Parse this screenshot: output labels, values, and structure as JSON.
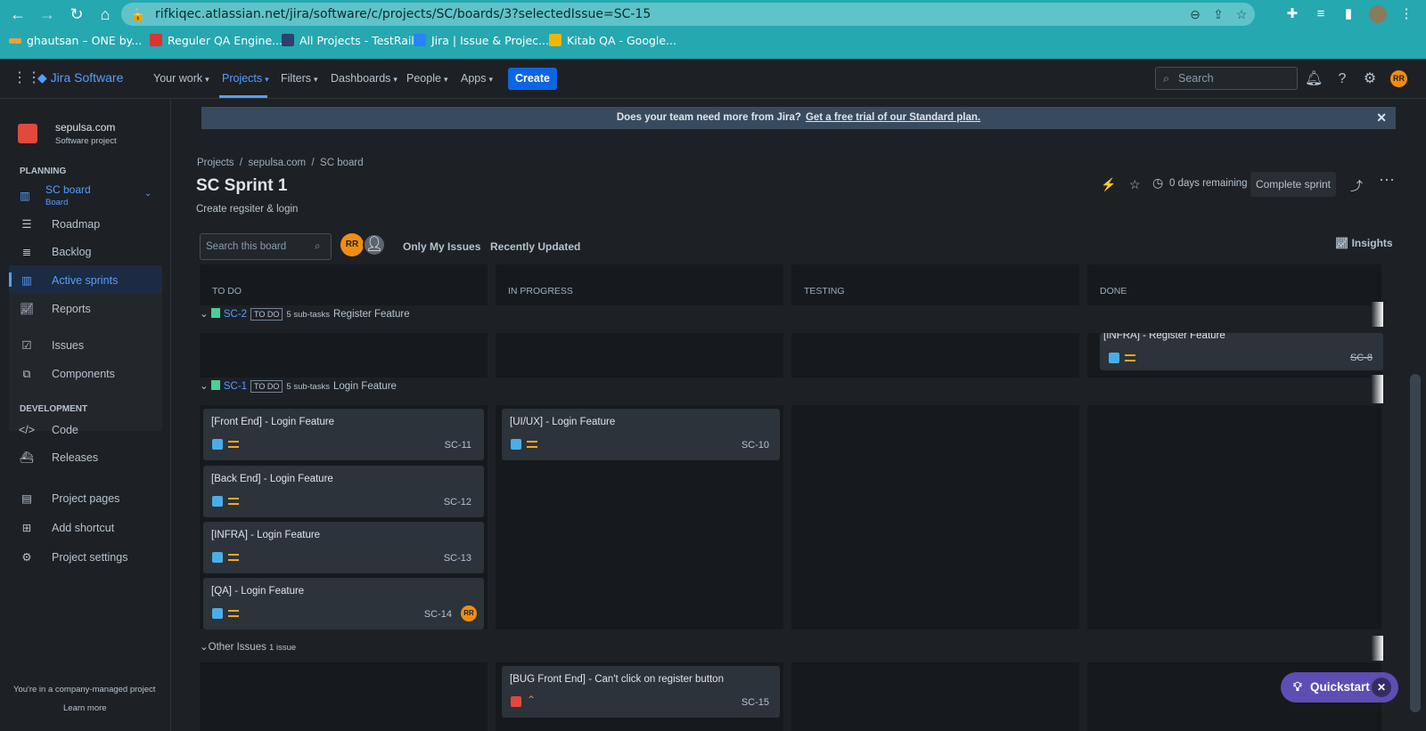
{
  "browser": {
    "url": "rifkiqec.atlassian.net/jira/software/c/projects/SC/boards/3?selectedIssue=SC-15",
    "bookmarks": [
      "ghautsan – ONE by...",
      "Reguler QA Engine...",
      "All Projects - TestRail",
      "Jira | Issue & Projec...",
      "Kitab QA - Google..."
    ]
  },
  "topnav": {
    "logo": "Jira Software",
    "items": [
      "Your work",
      "Projects",
      "Filters",
      "Dashboards",
      "People",
      "Apps"
    ],
    "create": "Create",
    "search_placeholder": "Search",
    "avatar": "RR"
  },
  "sidebar": {
    "project_name": "sepulsa.com",
    "project_type": "Software project",
    "planning_header": "PLANNING",
    "board_name": "SC board",
    "board_sub": "Board",
    "planning_items": [
      "Roadmap",
      "Backlog",
      "Active sprints",
      "Reports"
    ],
    "other_items": [
      "Issues",
      "Components"
    ],
    "development_header": "DEVELOPMENT",
    "development_items": [
      "Code",
      "Releases"
    ],
    "bottom_items": [
      "Project pages",
      "Add shortcut",
      "Project settings"
    ],
    "footer_text": "You're in a company-managed project",
    "footer_link": "Learn more"
  },
  "banner": {
    "text": "Does your team need more from Jira?",
    "link": "Get a free trial of our Standard plan."
  },
  "board": {
    "breadcrumb": "Projects  /  sepulsa.com  /  SC board",
    "title": "SC Sprint 1",
    "subtitle": "Create regsiter & login",
    "days_remaining": "0 days remaining",
    "complete_sprint": "Complete sprint",
    "search_placeholder": "Search this board",
    "avatar": "RR",
    "filter_my": "Only My Issues",
    "filter_recent": "Recently Updated",
    "insights": "Insights",
    "columns": [
      "TO DO",
      "IN PROGRESS",
      "TESTING",
      "DONE"
    ]
  },
  "swimlanes": [
    {
      "key": "SC-2",
      "status": "TO DO",
      "subtasks": "5 sub-tasks",
      "title": "Register Feature"
    },
    {
      "key": "SC-1",
      "status": "TO DO",
      "subtasks": "5 sub-tasks",
      "title": "Login Feature"
    },
    {
      "key": "",
      "status": "",
      "subtasks": "1 issue",
      "title": "Other Issues"
    }
  ],
  "cards": {
    "done_sc8": {
      "title": "[INFRA] - Register Feature",
      "key": "SC-8"
    },
    "todo": [
      {
        "title": "[Front End] - Login Feature",
        "key": "SC-11"
      },
      {
        "title": "[Back End] - Login Feature",
        "key": "SC-12"
      },
      {
        "title": "[INFRA] - Login Feature",
        "key": "SC-13"
      },
      {
        "title": "[QA] - Login Feature",
        "key": "SC-14",
        "assignee": "RR"
      }
    ],
    "inprogress": [
      {
        "title": "[UI/UX] - Login Feature",
        "key": "SC-10"
      }
    ],
    "bug": {
      "title": "[BUG Front End] - Can't click on register button",
      "key": "SC-15"
    }
  },
  "quickstart": "Quickstart",
  "colors": {
    "browser": "#25a8b0",
    "accent": "#579dff",
    "create": "#0c66e4",
    "avatar": "#f18d13",
    "quickstart": "#5e4db2"
  }
}
